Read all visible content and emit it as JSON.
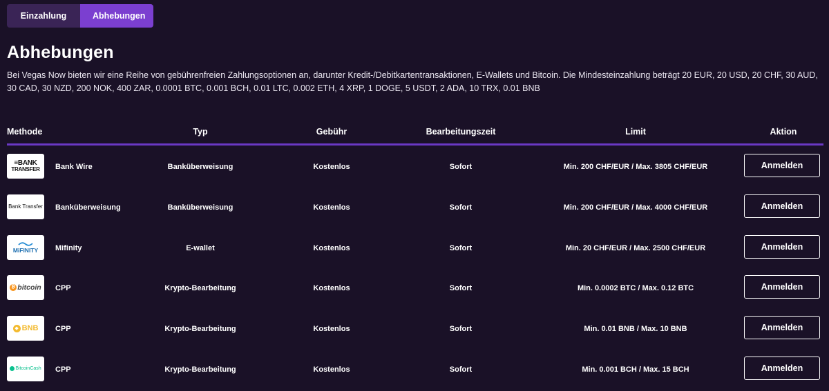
{
  "tabs": [
    {
      "label": "Einzahlung",
      "active": false
    },
    {
      "label": "Abhebungen",
      "active": true
    }
  ],
  "page_title": "Abhebungen",
  "intro": "Bei Vegas Now bieten wir eine Reihe von gebührenfreien Zahlungsoptionen an, darunter Kredit-/Debitkartentransaktionen, E-Wallets und Bitcoin. Die Mindesteinzahlung beträgt 20 EUR, 20 USD, 20 CHF, 30 AUD, 30 CAD, 30 NZD, 200 NOK, 400 ZAR, 0.0001 BTC, 0.001 BCH, 0.01 LTC, 0.002 ETH, 4 XRP, 1 DOGE, 5 USDT, 2 ADA, 10 TRX, 0.01 BNB",
  "table": {
    "headers": {
      "method": "Methode",
      "type": "Typ",
      "fee": "Gebühr",
      "time": "Bearbeitungszeit",
      "limit": "Limit",
      "action": "Aktion"
    },
    "rows": [
      {
        "logo_text": "≡BANK TRANSFER",
        "logo_icon": "bank-transfer-logo",
        "name": "Bank Wire",
        "type": "Banküberweisung",
        "fee": "Kostenlos",
        "time": "Sofort",
        "limit": "Min. 200 CHF/EUR / Max. 3805 CHF/EUR",
        "action": "Anmelden"
      },
      {
        "logo_text": "Bank Transfer",
        "logo_icon": "bank-transfer-text-logo",
        "name": "Banküberweisung",
        "type": "Banküberweisung",
        "fee": "Kostenlos",
        "time": "Sofort",
        "limit": "Min. 200 CHF/EUR / Max. 4000 CHF/EUR",
        "action": "Anmelden"
      },
      {
        "logo_text": "MiFINITY",
        "logo_icon": "mifinity-logo",
        "name": "Mifinity",
        "type": "E-wallet",
        "fee": "Kostenlos",
        "time": "Sofort",
        "limit": "Min. 20 CHF/EUR / Max. 2500 CHF/EUR",
        "action": "Anmelden"
      },
      {
        "logo_text": "bitcoin",
        "logo_icon": "bitcoin-logo",
        "name": "CPP",
        "type": "Krypto-Bearbeitung",
        "fee": "Kostenlos",
        "time": "Sofort",
        "limit": "Min. 0.0002 BTC / Max. 0.12 BTC",
        "action": "Anmelden"
      },
      {
        "logo_text": "BNB",
        "logo_icon": "bnb-logo",
        "name": "CPP",
        "type": "Krypto-Bearbeitung",
        "fee": "Kostenlos",
        "time": "Sofort",
        "limit": "Min. 0.01 BNB / Max. 10 BNB",
        "action": "Anmelden"
      },
      {
        "logo_text": "BitcoinCash",
        "logo_icon": "bitcoin-cash-logo",
        "name": "CPP",
        "type": "Krypto-Bearbeitung",
        "fee": "Kostenlos",
        "time": "Sofort",
        "limit": "Min. 0.001 BCH / Max. 15 BCH",
        "action": "Anmelden"
      }
    ]
  },
  "colors": {
    "background": "#1a1127",
    "tab_inactive": "#3a2456",
    "tab_active": "#7b3fd0",
    "header_rule": "#6a38c4",
    "bitcoin_orange": "#f7931a",
    "bnb_yellow": "#f3ba2f",
    "bch_green": "#0ac18e",
    "mifinity_blue": "#2a8fd6"
  }
}
